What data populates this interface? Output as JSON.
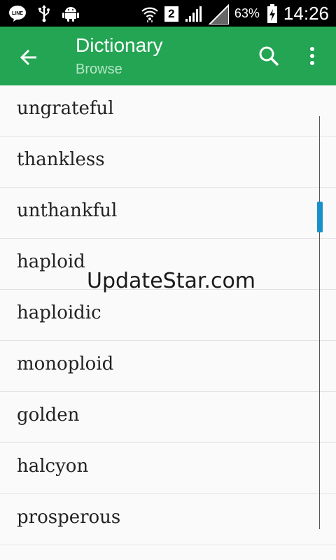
{
  "status_bar": {
    "left_icons": [
      "line-icon",
      "usb-icon",
      "android-icon"
    ],
    "sim_badge": "2",
    "battery_percent": "63%",
    "time": "14:26"
  },
  "app_bar": {
    "title": "Dictionary",
    "subtitle": "Browse",
    "color": "#23a553"
  },
  "words": [
    "ungrateful",
    "thankless",
    "unthankful",
    "haploid",
    "haploidic",
    "monoploid",
    "golden",
    "halcyon",
    "prosperous"
  ],
  "watermark": "UpdateStar.com",
  "accent": "#1a90c8"
}
